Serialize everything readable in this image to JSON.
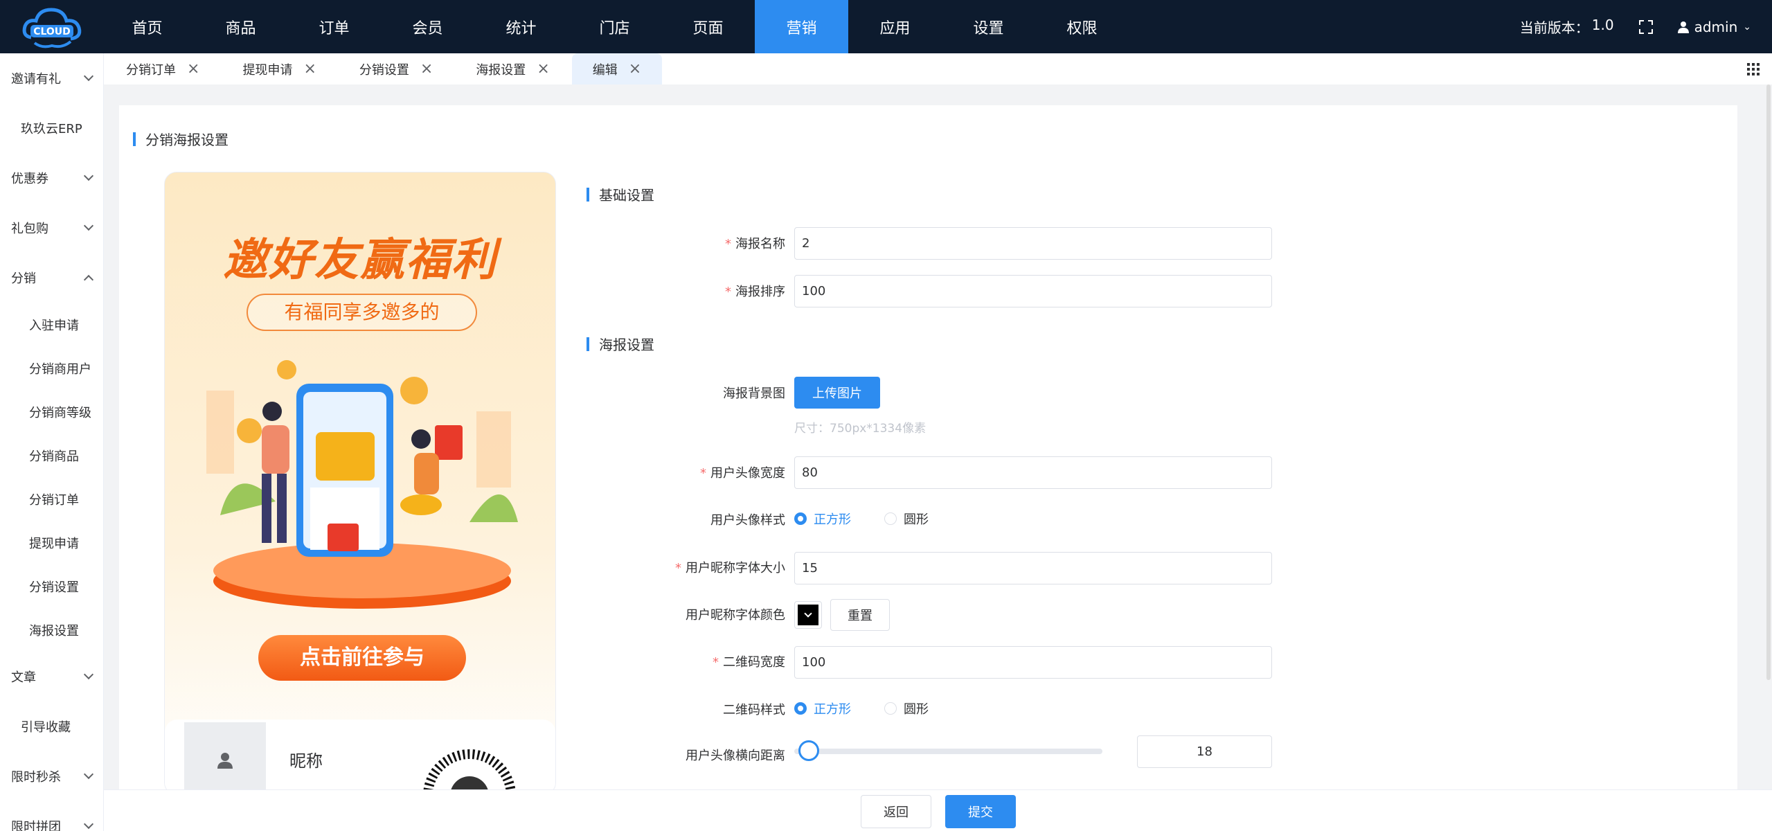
{
  "app": {
    "logo_text": "CLOUD"
  },
  "nav": {
    "items": [
      "首页",
      "商品",
      "订单",
      "会员",
      "统计",
      "门店",
      "页面",
      "营销",
      "应用",
      "设置",
      "权限"
    ],
    "active_index": 7,
    "version_label": "当前版本：",
    "version_value": "1.0",
    "user": "admin"
  },
  "sidebar": {
    "items": [
      {
        "label": "邀请有礼",
        "type": "group",
        "open": false
      },
      {
        "label": "玖玖云ERP",
        "type": "single"
      },
      {
        "label": "优惠券",
        "type": "group",
        "open": false
      },
      {
        "label": "礼包购",
        "type": "group",
        "open": false
      },
      {
        "label": "分销",
        "type": "group",
        "open": true
      },
      {
        "label": "入驻申请",
        "type": "sub"
      },
      {
        "label": "分销商用户",
        "type": "sub"
      },
      {
        "label": "分销商等级",
        "type": "sub"
      },
      {
        "label": "分销商品",
        "type": "sub"
      },
      {
        "label": "分销订单",
        "type": "sub"
      },
      {
        "label": "提现申请",
        "type": "sub"
      },
      {
        "label": "分销设置",
        "type": "sub"
      },
      {
        "label": "海报设置",
        "type": "sub"
      },
      {
        "label": "文章",
        "type": "group",
        "open": false
      },
      {
        "label": "引导收藏",
        "type": "single"
      },
      {
        "label": "限时秒杀",
        "type": "group",
        "open": false
      },
      {
        "label": "限时拼团",
        "type": "group",
        "open": false
      }
    ]
  },
  "tabs": {
    "items": [
      "分销订单",
      "提现申请",
      "分销设置",
      "海报设置",
      "编辑"
    ],
    "active_index": 4
  },
  "page": {
    "title": "分销海报设置"
  },
  "poster": {
    "headline": "邀好友赢福利",
    "subline": "有福同享多邀多的",
    "cta": "点击前往参与",
    "nickname": "昵称"
  },
  "form": {
    "basic_title": "基础设置",
    "poster_title": "海报设置",
    "name_label": "海报名称",
    "name_value": "2",
    "sort_label": "海报排序",
    "sort_value": "100",
    "bg_label": "海报背景图",
    "upload_label": "上传图片",
    "size_hint": "尺寸：750px*1334像素",
    "avatar_width_label": "用户头像宽度",
    "avatar_width_value": "80",
    "avatar_style_label": "用户头像样式",
    "opt_square": "正方形",
    "opt_circle": "圆形",
    "font_size_label": "用户昵称字体大小",
    "font_size_value": "15",
    "font_color_label": "用户昵称字体颜色",
    "font_color_value": "#000000",
    "reset_label": "重置",
    "qr_width_label": "二维码宽度",
    "qr_width_value": "100",
    "qr_style_label": "二维码样式",
    "avatar_x_label": "用户头像横向距离",
    "avatar_x_value": "18"
  },
  "footer": {
    "back_label": "返回",
    "submit_label": "提交"
  },
  "colors": {
    "primary": "#2d8cf0",
    "topbar": "#0d1b2e",
    "accent_orange": "#f06a14"
  }
}
